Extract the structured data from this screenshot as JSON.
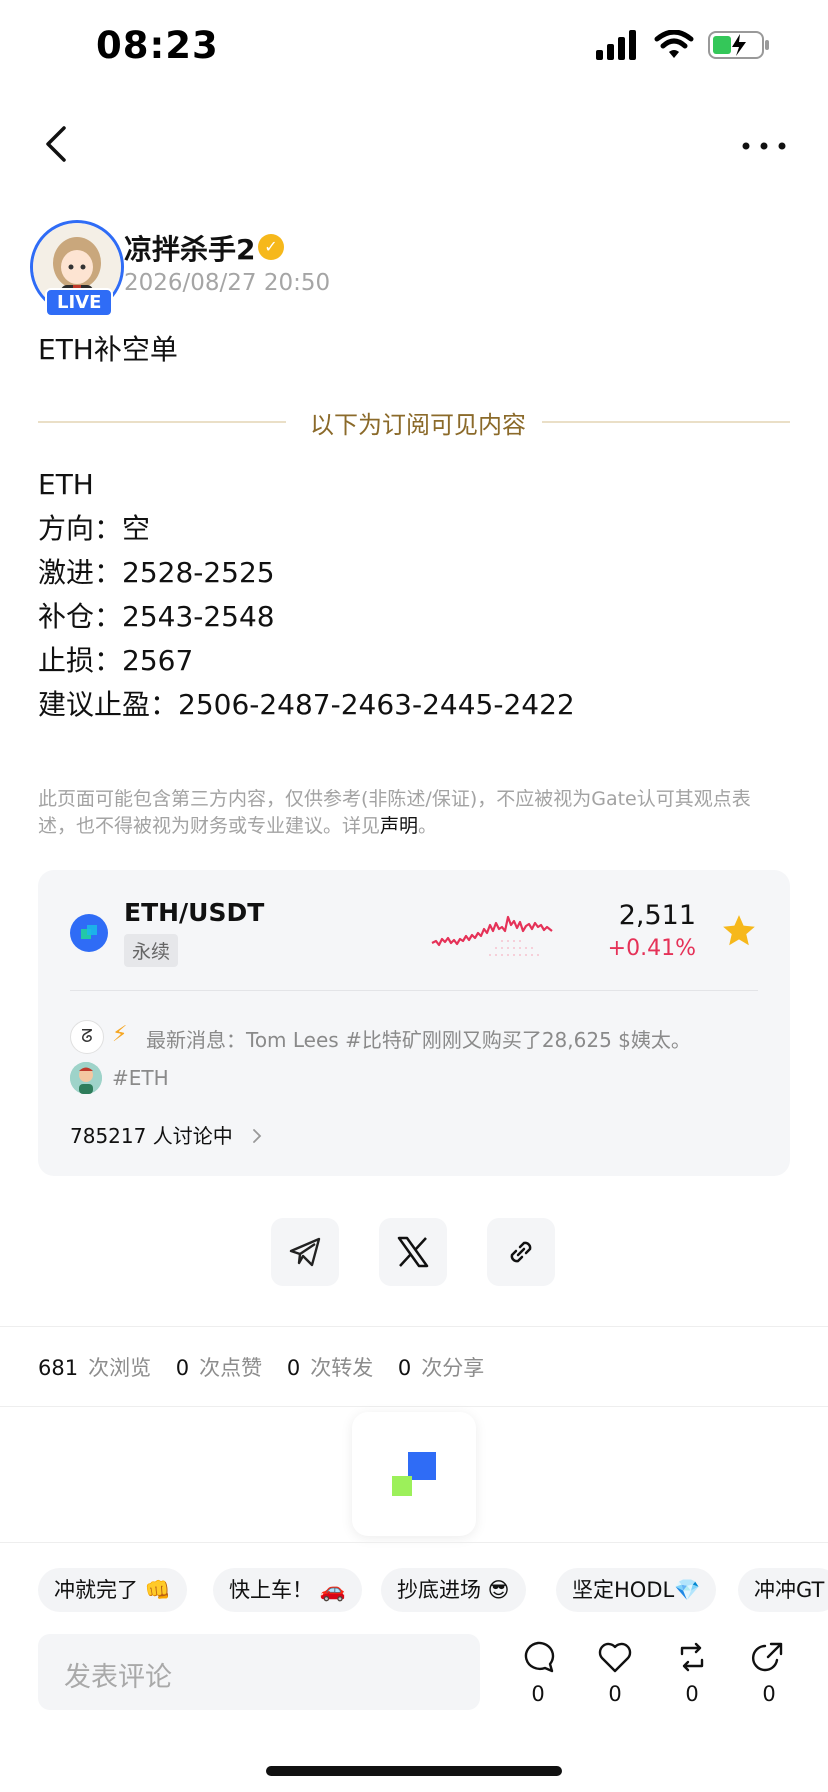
{
  "status_bar": {
    "time": "08:23"
  },
  "author": {
    "name": "凉拌杀手2",
    "live_label": "LIVE",
    "timestamp": "2026/08/27 20:50"
  },
  "post": {
    "title": "ETH补空单",
    "subscription_divider": "以下为订阅可见内容",
    "lines": [
      "ETH",
      "",
      "方向：空",
      "激进：2528-2525",
      "补仓：2543-2548",
      "止损：2567",
      "建议止盈：2506-2487-2463-2445-2422"
    ],
    "disclaimer_text": "此页面可能包含第三方内容，仅供参考(非陈述/保证)，不应被视为Gate认可其观点表述，也不得被视为财务或专业建议。详见",
    "disclaimer_link": "声明",
    "disclaimer_end": "。"
  },
  "market_card": {
    "pair": "ETH/USDT",
    "type_tag": "永续",
    "price": "2,511",
    "change": "+0.41%",
    "news_prefix": "最新消息：",
    "news_text": "最新消息：Tom Lees #比特矿刚刚又购买了28,625 $姨太。",
    "tag": "#ETH",
    "discussion": "785217 人讨论中",
    "colors": {
      "change": "#e53258",
      "accent": "#2f6cf6",
      "star": "#f6b81b"
    }
  },
  "share_icons": [
    "telegram-icon",
    "x-icon",
    "link-icon"
  ],
  "stats": {
    "views": "681",
    "views_label": "次浏览",
    "likes": "0",
    "likes_label": "次点赞",
    "reposts": "0",
    "reposts_label": "次转发",
    "shares": "0",
    "shares_label": "次分享"
  },
  "quick_replies": [
    "冲就完了 👊",
    "快上车！ 🚗",
    "抄底进场 😎",
    "坚定HODL💎",
    "冲冲GT"
  ],
  "comment_bar": {
    "placeholder": "发表评论",
    "comment_count": "0",
    "like_count": "0",
    "repost_count": "0",
    "share_count": "0"
  }
}
